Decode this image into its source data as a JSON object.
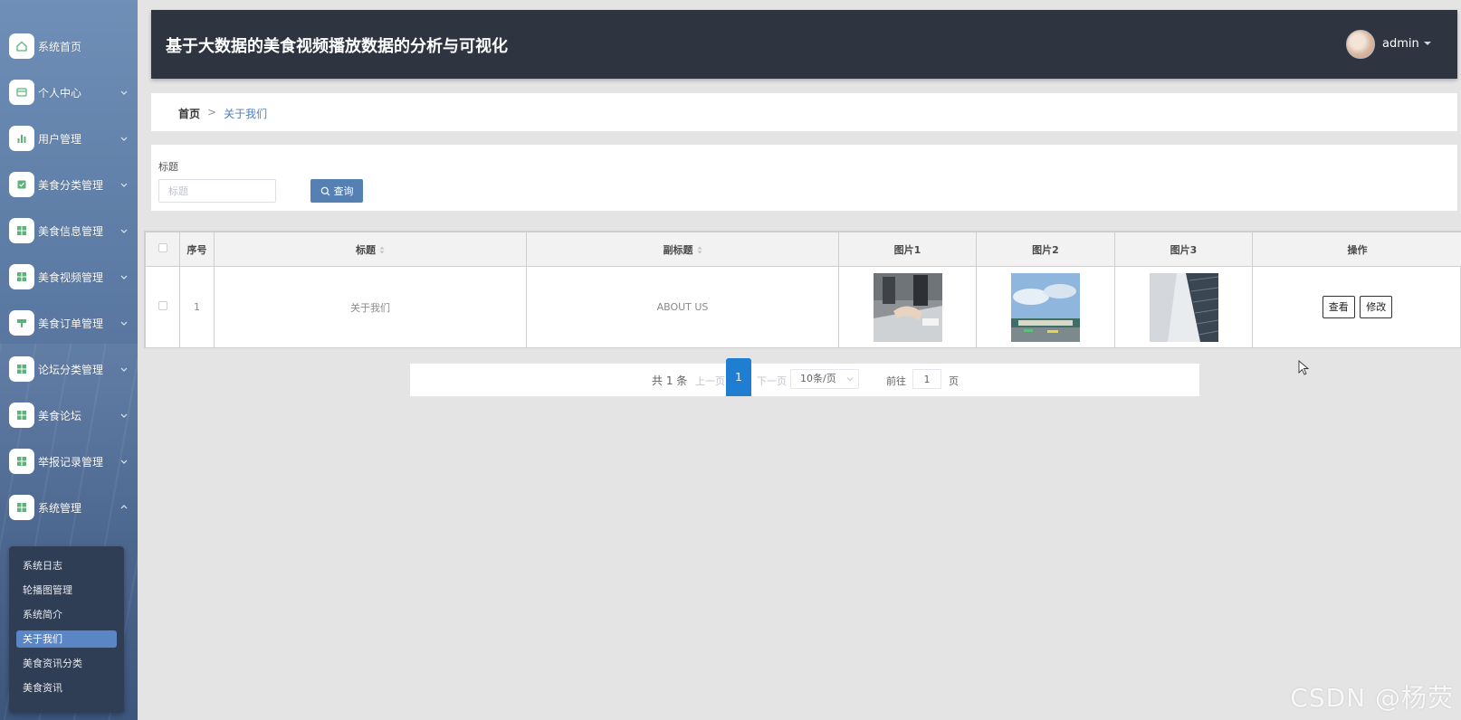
{
  "header": {
    "title": "基于大数据的美食视频播放数据的分析与可视化",
    "user": "admin"
  },
  "sidebar": {
    "items": [
      {
        "label": "系统首页",
        "icon": "home-icon",
        "has_arrow": false
      },
      {
        "label": "个人中心",
        "icon": "profile-icon",
        "has_arrow": true
      },
      {
        "label": "用户管理",
        "icon": "chart-icon",
        "has_arrow": true
      },
      {
        "label": "美食分类管理",
        "icon": "category-icon",
        "has_arrow": true
      },
      {
        "label": "美食信息管理",
        "icon": "grid-icon",
        "has_arrow": true
      },
      {
        "label": "美食视频管理",
        "icon": "grid-icon",
        "has_arrow": true
      },
      {
        "label": "美食订单管理",
        "icon": "order-icon",
        "has_arrow": true
      },
      {
        "label": "论坛分类管理",
        "icon": "grid-icon",
        "has_arrow": true
      },
      {
        "label": "美食论坛",
        "icon": "grid-icon",
        "has_arrow": true
      },
      {
        "label": "举报记录管理",
        "icon": "grid-icon",
        "has_arrow": true
      },
      {
        "label": "系统管理",
        "icon": "grid-icon",
        "has_arrow": true,
        "expanded": true
      }
    ],
    "submenu": [
      {
        "label": "系统日志"
      },
      {
        "label": "轮播图管理"
      },
      {
        "label": "系统简介"
      },
      {
        "label": "关于我们",
        "active": true
      },
      {
        "label": "美食资讯分类"
      },
      {
        "label": "美食资讯"
      }
    ]
  },
  "breadcrumb": {
    "home": "首页",
    "separator": ">",
    "current": "关于我们"
  },
  "search": {
    "label": "标题",
    "placeholder": "标题",
    "value": "",
    "button": "查询"
  },
  "table": {
    "headers": {
      "index": "序号",
      "title": "标题",
      "subtitle": "副标题",
      "image1": "图片1",
      "image2": "图片2",
      "image3": "图片3",
      "actions": "操作"
    },
    "rows": [
      {
        "index": "1",
        "title": "关于我们",
        "subtitle": "ABOUT US",
        "view": "查看",
        "edit": "修改"
      }
    ]
  },
  "pagination": {
    "total": "共 1 条",
    "prev": "上一页",
    "page": "1",
    "next": "下一页",
    "page_size": "10条/页",
    "goto": "前往",
    "goto_value": "1",
    "unit": "页"
  },
  "watermark": "CSDN @杨荧",
  "colors": {
    "header_bg": "#2e3440",
    "accent": "#5580b4",
    "active_page": "#1f7ed1",
    "icon_green": "#4caf6a"
  }
}
